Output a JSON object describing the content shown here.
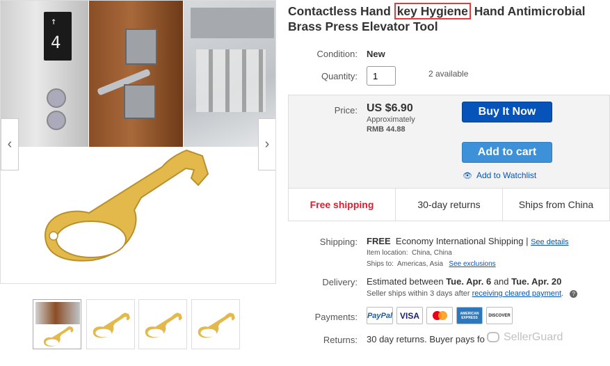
{
  "title": {
    "before": "Contactless Hand ",
    "highlight": "key Hygiene",
    "after": " Hand Antimicrobial Brass Press Elevator Tool"
  },
  "condition": {
    "label": "Condition:",
    "value": "New"
  },
  "quantity": {
    "label": "Quantity:",
    "value": "1",
    "available": "2 available"
  },
  "price": {
    "label": "Price:",
    "amount": "US $6.90",
    "approx_label": "Approximately",
    "approx_value": "RMB 44.88"
  },
  "actions": {
    "buy_now": "Buy It Now",
    "add_to_cart": "Add to cart",
    "watchlist": "Add to Watchlist"
  },
  "features": [
    "Free shipping",
    "30-day returns",
    "Ships from China"
  ],
  "shipping": {
    "label": "Shipping:",
    "free": "FREE",
    "method": "Economy International Shipping |",
    "see_details": "See details",
    "item_location_label": "Item location:",
    "item_location": "China, China",
    "ships_to_label": "Ships to:",
    "ships_to": "Americas, Asia",
    "see_exclusions": "See exclusions"
  },
  "delivery": {
    "label": "Delivery:",
    "text_prefix": "Estimated between ",
    "date1": "Tue. Apr. 6",
    "and": " and ",
    "date2": "Tue. Apr. 20",
    "note_prefix": "Seller ships within 3 days after ",
    "note_link": "receiving cleared payment",
    "note_suffix": "."
  },
  "payments": {
    "label": "Payments:",
    "methods": [
      "PayPal",
      "VISA",
      "MasterCard",
      "AMERICAN EXPRESS",
      "DISCOVER"
    ]
  },
  "returns": {
    "label": "Returns:",
    "text": "30 day returns. Buyer pays fo",
    "watermark": "SellerGuard"
  },
  "colors": {
    "accent": "#0654ba",
    "highlight": "#e23b3b",
    "free_shipping": "#dd1e31",
    "tool": "#e3b94b"
  }
}
